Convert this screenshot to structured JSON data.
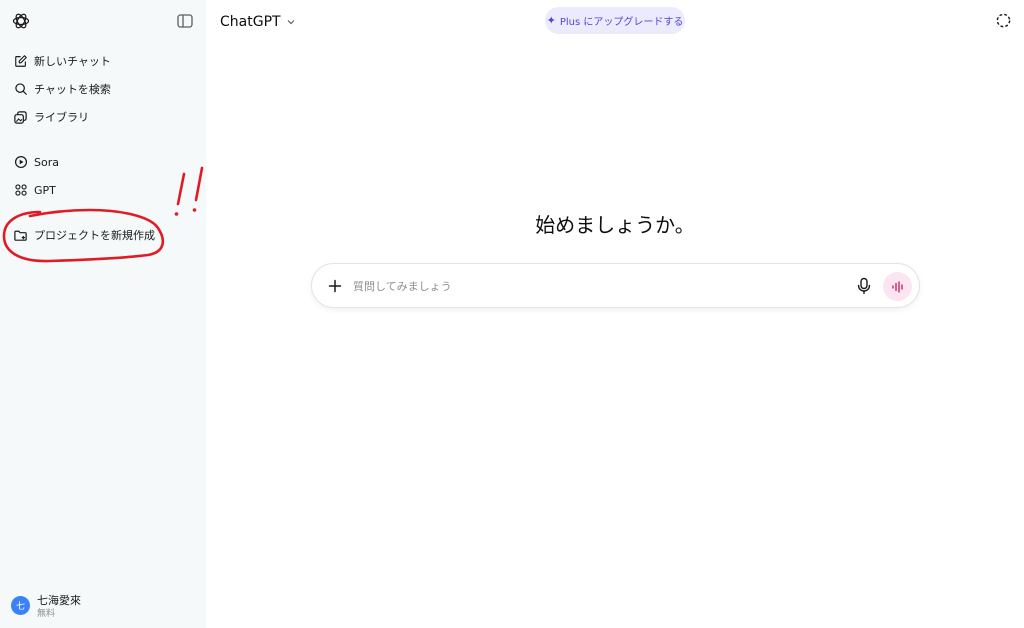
{
  "sidebar": {
    "items": [
      {
        "label": "新しいチャット",
        "icon": "new-chat-icon"
      },
      {
        "label": "チャットを検索",
        "icon": "search-icon"
      },
      {
        "label": "ライブラリ",
        "icon": "library-icon"
      },
      {
        "label": "Sora",
        "icon": "play-circle-icon"
      },
      {
        "label": "GPT",
        "icon": "grid-icon"
      },
      {
        "label": "プロジェクトを新規作成",
        "icon": "new-project-icon"
      }
    ],
    "user": {
      "avatar": "七",
      "name": "七海愛來",
      "plan": "無料"
    }
  },
  "header": {
    "model": "ChatGPT",
    "upgrade": {
      "star": "✦",
      "label": "Plus にアップグレードする"
    }
  },
  "main": {
    "heading": "始めましょうか。",
    "composer": {
      "placeholder": "質問してみましょう"
    }
  },
  "colors": {
    "sidebar_bg": "#f5f9f9",
    "upgrade_bg": "#eceafd",
    "upgrade_text": "#5147d6",
    "annotation_red": "#e01b24",
    "avatar": "#3b82f6",
    "voice_bg": "#fde4f1"
  }
}
